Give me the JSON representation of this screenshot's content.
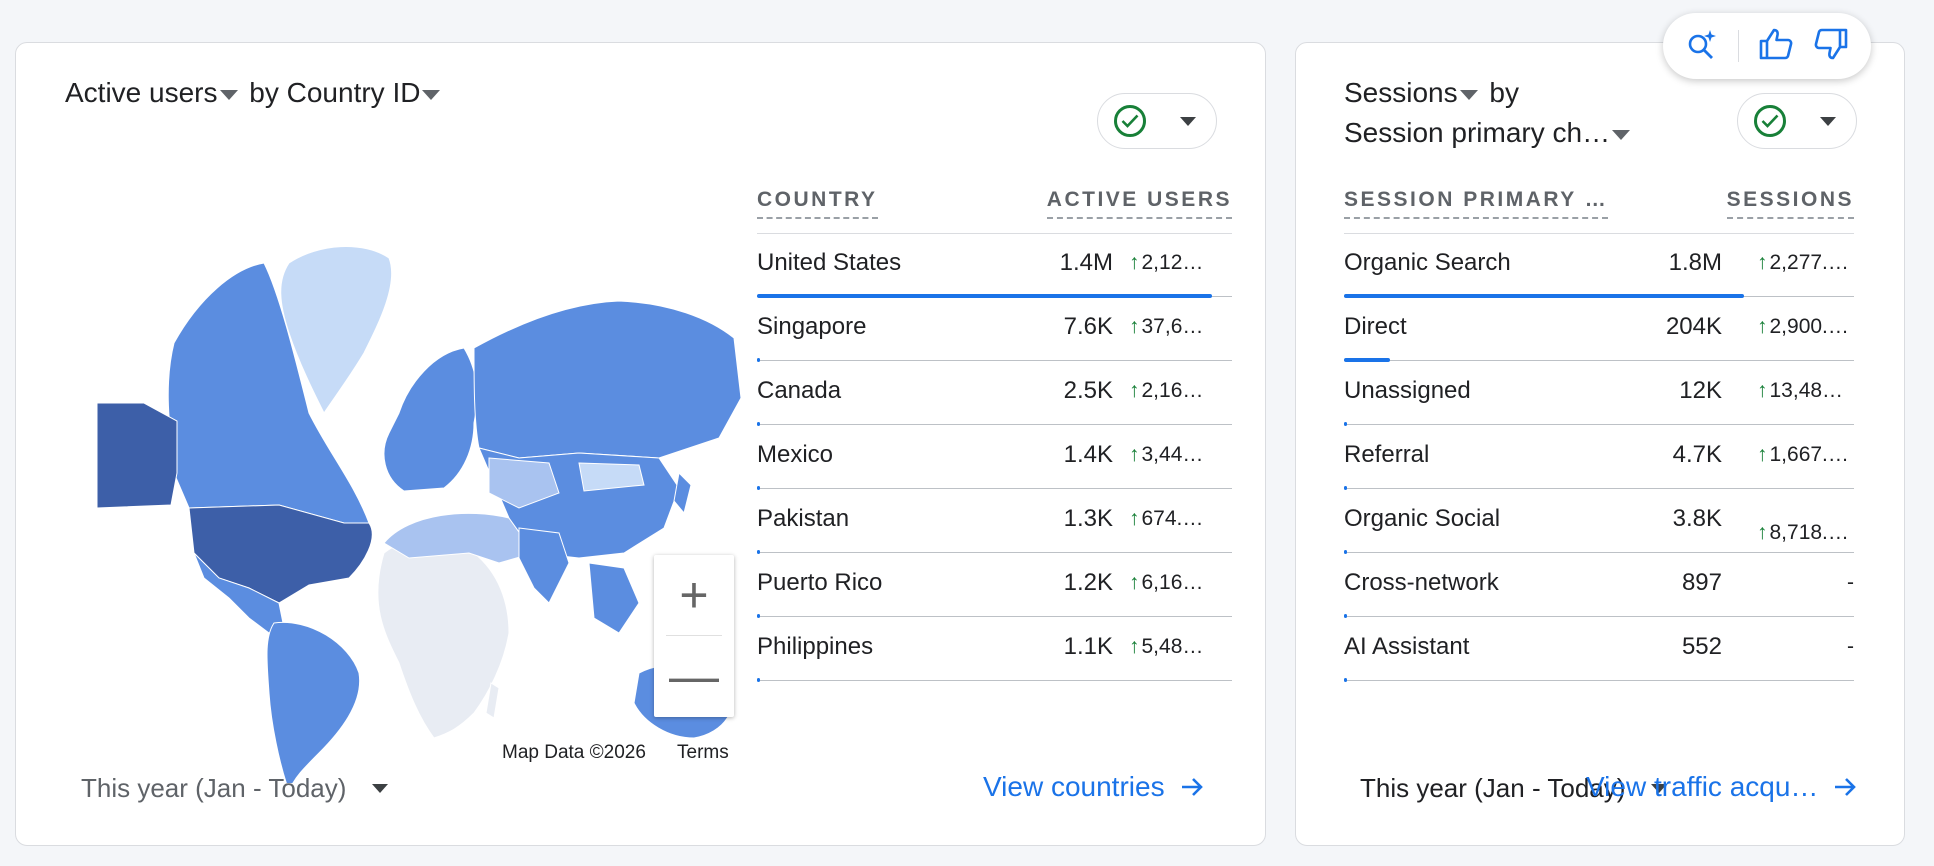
{
  "left_card": {
    "title_metric": "Active users",
    "title_by": "by",
    "title_dimension": "Country ID",
    "table_headers": {
      "dimension": "COUNTRY",
      "metric": "ACTIVE USERS"
    },
    "rows": [
      {
        "name": "United States",
        "value": "1.4M",
        "change": "2,12…",
        "share": 1.0
      },
      {
        "name": "Singapore",
        "value": "7.6K",
        "change": "37,6…",
        "share": 0.006
      },
      {
        "name": "Canada",
        "value": "2.5K",
        "change": "2,16…",
        "share": 0.003
      },
      {
        "name": "Mexico",
        "value": "1.4K",
        "change": "3,44…",
        "share": 0.002
      },
      {
        "name": "Pakistan",
        "value": "1.3K",
        "change": "674.…",
        "share": 0.002
      },
      {
        "name": "Puerto Rico",
        "value": "1.2K",
        "change": "6,16…",
        "share": 0.002
      },
      {
        "name": "Philippines",
        "value": "1.1K",
        "change": "5,48…",
        "share": 0.002
      }
    ],
    "map_attribution": "Map Data ©2026",
    "map_terms": "Terms",
    "zoom_in": "+",
    "zoom_out": "—",
    "date_range": "This year (Jan - Today)",
    "view_link": "View countries"
  },
  "right_card": {
    "title_metric": "Sessions",
    "title_by": "by",
    "title_dimension": "Session primary ch…",
    "table_headers": {
      "dimension": "SESSION PRIMARY …",
      "metric": "SESSIONS"
    },
    "rows": [
      {
        "name": "Organic Search",
        "value": "1.8M",
        "change": "2,277.…",
        "share": 0.88
      },
      {
        "name": "Direct",
        "value": "204K",
        "change": "2,900.…",
        "share": 0.1
      },
      {
        "name": "Unassigned",
        "value": "12K",
        "change": "13,48…",
        "share": 0.006
      },
      {
        "name": "Referral",
        "value": "4.7K",
        "change": "1,667.…",
        "share": 0.003
      },
      {
        "name": "Organic Social",
        "value": "3.8K",
        "change": "8,718.…",
        "share": 0.002
      },
      {
        "name": "Cross-network",
        "value": "897",
        "change": "-",
        "share": 0.001
      },
      {
        "name": "AI Assistant",
        "value": "552",
        "change": "-",
        "share": 0.001
      }
    ],
    "date_range": "This year (Jan - Today)",
    "view_link": "View traffic acqu…"
  },
  "colors": {
    "accent": "#1a73e8",
    "positive": "#188038",
    "map_dark": "#3d5fa8",
    "map_mid": "#5b8de0",
    "map_light": "#c6dbf7"
  },
  "icons": {
    "insights": "search-sparkle-icon",
    "thumbs_up": "thumbs-up-icon",
    "thumbs_down": "thumbs-down-icon",
    "check": "check-circle-icon",
    "arrow": "arrow-right-icon",
    "up": "arrow-up-icon"
  }
}
